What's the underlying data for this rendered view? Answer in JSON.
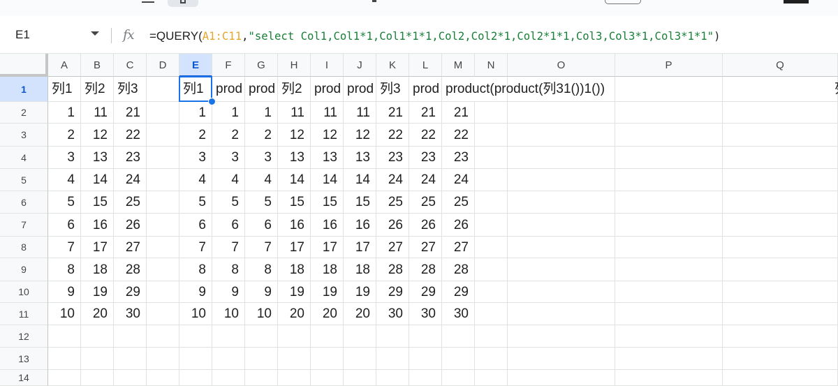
{
  "formula_bar": {
    "name_box": "E1",
    "fx_label": "fx",
    "formula_eq": "=QUERY(",
    "formula_range": "A1:C11",
    "formula_sep": ",",
    "formula_string": "\"select Col1,Col1*1,Col1*1*1,Col2,Col2*1,Col2*1*1,Col3,Col3*1,Col3*1*1\"",
    "formula_close": ")"
  },
  "sheet": {
    "selected_cell": "E1",
    "columns": [
      {
        "letter": "A"
      },
      {
        "letter": "B"
      },
      {
        "letter": "C"
      },
      {
        "letter": "D"
      },
      {
        "letter": "E",
        "selected": true
      },
      {
        "letter": "F"
      },
      {
        "letter": "G"
      },
      {
        "letter": "H"
      },
      {
        "letter": "I"
      },
      {
        "letter": "J"
      },
      {
        "letter": "K"
      },
      {
        "letter": "L"
      },
      {
        "letter": "M"
      },
      {
        "letter": "N"
      },
      {
        "letter": "O"
      },
      {
        "letter": "P"
      },
      {
        "letter": "Q"
      }
    ],
    "rows": [
      {
        "num": "1",
        "cells": [
          "列1",
          "列2",
          "列3",
          "",
          "列1",
          "prod",
          "prod",
          "列2",
          "prod",
          "prod",
          "列3",
          "prod",
          "product(product(列31())1())",
          "",
          "",
          "",
          ""
        ]
      },
      {
        "num": "2",
        "cells": [
          "1",
          "11",
          "21",
          "",
          "1",
          "1",
          "1",
          "11",
          "11",
          "11",
          "21",
          "21",
          "21",
          "",
          "",
          "",
          ""
        ]
      },
      {
        "num": "3",
        "cells": [
          "2",
          "12",
          "22",
          "",
          "2",
          "2",
          "2",
          "12",
          "12",
          "12",
          "22",
          "22",
          "22",
          "",
          "",
          "",
          ""
        ]
      },
      {
        "num": "4",
        "cells": [
          "3",
          "13",
          "23",
          "",
          "3",
          "3",
          "3",
          "13",
          "13",
          "13",
          "23",
          "23",
          "23",
          "",
          "",
          "",
          ""
        ]
      },
      {
        "num": "5",
        "cells": [
          "4",
          "14",
          "24",
          "",
          "4",
          "4",
          "4",
          "14",
          "14",
          "14",
          "24",
          "24",
          "24",
          "",
          "",
          "",
          ""
        ]
      },
      {
        "num": "6",
        "cells": [
          "5",
          "15",
          "25",
          "",
          "5",
          "5",
          "5",
          "15",
          "15",
          "15",
          "25",
          "25",
          "25",
          "",
          "",
          "",
          ""
        ]
      },
      {
        "num": "7",
        "cells": [
          "6",
          "16",
          "26",
          "",
          "6",
          "6",
          "6",
          "16",
          "16",
          "16",
          "26",
          "26",
          "26",
          "",
          "",
          "",
          ""
        ]
      },
      {
        "num": "8",
        "cells": [
          "7",
          "17",
          "27",
          "",
          "7",
          "7",
          "7",
          "17",
          "17",
          "17",
          "27",
          "27",
          "27",
          "",
          "",
          "",
          ""
        ]
      },
      {
        "num": "9",
        "cells": [
          "8",
          "18",
          "28",
          "",
          "8",
          "8",
          "8",
          "18",
          "18",
          "18",
          "28",
          "28",
          "28",
          "",
          "",
          "",
          ""
        ]
      },
      {
        "num": "10",
        "cells": [
          "9",
          "19",
          "29",
          "",
          "9",
          "9",
          "9",
          "19",
          "19",
          "19",
          "29",
          "29",
          "29",
          "",
          "",
          "",
          ""
        ]
      },
      {
        "num": "11",
        "cells": [
          "10",
          "20",
          "30",
          "",
          "10",
          "10",
          "10",
          "20",
          "20",
          "20",
          "30",
          "30",
          "30",
          "",
          "",
          "",
          ""
        ]
      },
      {
        "num": "12",
        "cells": [
          "",
          "",
          "",
          "",
          "",
          "",
          "",
          "",
          "",
          "",
          "",
          "",
          "",
          "",
          "",
          "",
          ""
        ]
      },
      {
        "num": "13",
        "cells": [
          "",
          "",
          "",
          "",
          "",
          "",
          "",
          "",
          "",
          "",
          "",
          "",
          "",
          "",
          "",
          "",
          ""
        ]
      },
      {
        "num": "14",
        "cells": [
          "",
          "",
          "",
          "",
          "",
          "",
          "",
          "",
          "",
          "",
          "",
          "",
          "",
          "",
          "",
          "",
          ""
        ]
      }
    ],
    "clipped_right_text": "列"
  }
}
